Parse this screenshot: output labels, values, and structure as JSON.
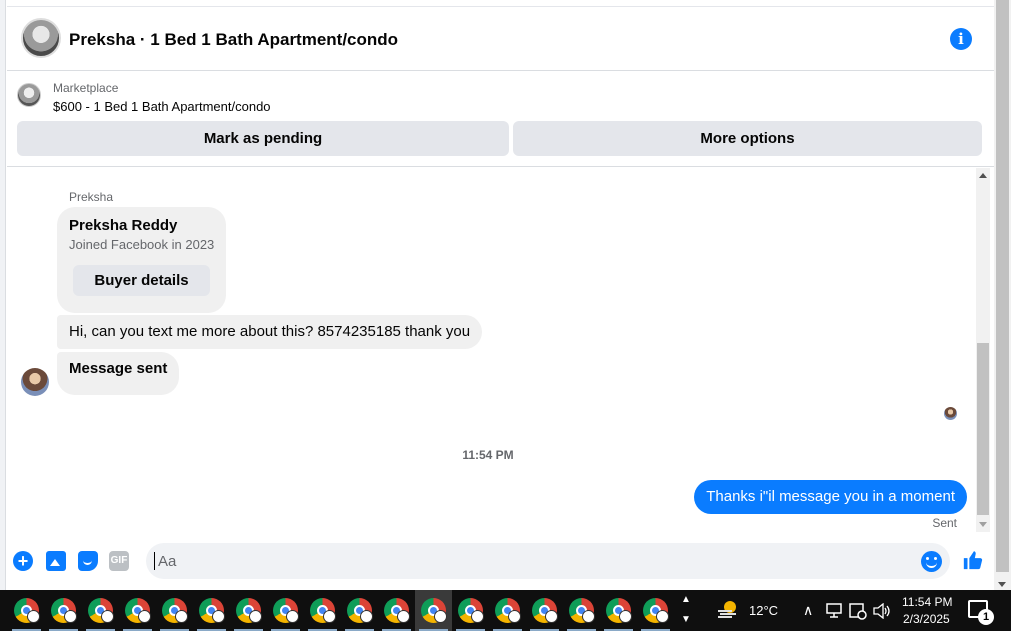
{
  "conversation": {
    "title": "Preksha · 1 Bed 1 Bath Apartment/condo",
    "info_icon": "info-icon",
    "listing": {
      "source": "Marketplace",
      "title": "$600 - 1 Bed 1 Bath Apartment/condo",
      "mark_pending_label": "Mark as pending",
      "more_options_label": "More options"
    },
    "sender_name": "Preksha",
    "buyer_card": {
      "name": "Preksha Reddy",
      "joined": "Joined Facebook in 2023",
      "button_label": "Buyer details"
    },
    "messages_in": [
      "Hi, can you text me more about this? 8574235185 thank you",
      "Message sent"
    ],
    "timestamp": "11:54 PM",
    "message_out": "Thanks i\"il message you in a moment",
    "sent_status": "Sent"
  },
  "composer": {
    "placeholder": "Aa",
    "gif_label": "GIF",
    "plus_label": "+"
  },
  "taskbar": {
    "temperature": "12°C",
    "time": "11:54 PM",
    "date": "2/3/2025",
    "notification_count": "1"
  },
  "colors": {
    "accent": "#0a7cff",
    "bubble_in": "#f0f0f0",
    "button_bg": "#e4e6eb",
    "secondary_text": "#65676b"
  }
}
